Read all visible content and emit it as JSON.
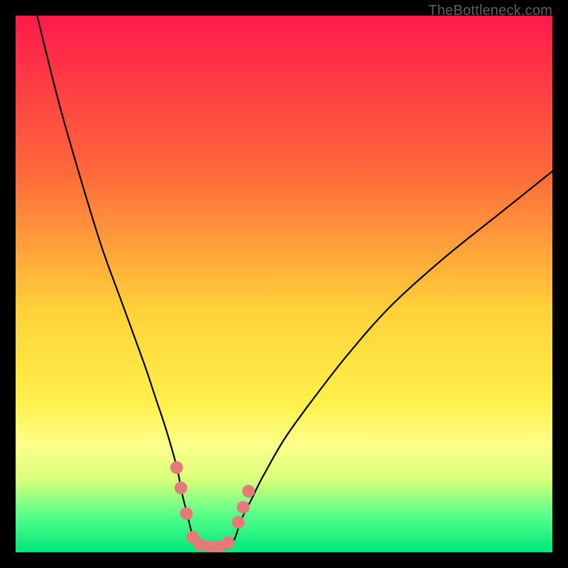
{
  "watermark": "TheBottleneck.com",
  "chart_data": {
    "type": "line",
    "title": "",
    "xlabel": "",
    "ylabel": "",
    "xlim": [
      0,
      100
    ],
    "ylim": [
      0,
      100
    ],
    "gradient_stops": [
      {
        "offset": 0.0,
        "color": "#ff1a4b"
      },
      {
        "offset": 0.3,
        "color": "#ff6b3a"
      },
      {
        "offset": 0.55,
        "color": "#ffd23a"
      },
      {
        "offset": 0.72,
        "color": "#fff04a"
      },
      {
        "offset": 0.8,
        "color": "#fdff8a"
      },
      {
        "offset": 0.865,
        "color": "#d8ff7a"
      },
      {
        "offset": 0.93,
        "color": "#58ff8a"
      },
      {
        "offset": 1.0,
        "color": "#00e77a"
      }
    ],
    "series": [
      {
        "name": "left-curve",
        "x": [
          4,
          8,
          12,
          16,
          20,
          24,
          26,
          28,
          30,
          31,
          32,
          33,
          34
        ],
        "y": [
          100,
          84,
          70,
          57,
          46,
          35,
          29,
          23,
          16,
          11,
          7,
          3,
          1
        ]
      },
      {
        "name": "right-curve",
        "x": [
          40,
          41,
          42,
          44,
          46,
          50,
          55,
          62,
          70,
          80,
          90,
          100
        ],
        "y": [
          1,
          3,
          6,
          10,
          14,
          21,
          28,
          37,
          46,
          55,
          63,
          71
        ]
      },
      {
        "name": "valley-floor",
        "x": [
          34,
          36,
          38,
          40
        ],
        "y": [
          1,
          0.5,
          0.5,
          1
        ]
      }
    ],
    "markers": {
      "color": "#e47a7a",
      "radius": 9,
      "points": [
        {
          "x": 30.0,
          "y": 15.8
        },
        {
          "x": 30.8,
          "y": 12.0
        },
        {
          "x": 31.8,
          "y": 7.2
        },
        {
          "x": 33.0,
          "y": 2.8
        },
        {
          "x": 34.3,
          "y": 1.4
        },
        {
          "x": 36.1,
          "y": 1.0
        },
        {
          "x": 38.0,
          "y": 1.0
        },
        {
          "x": 39.6,
          "y": 1.8
        },
        {
          "x": 41.5,
          "y": 5.6
        },
        {
          "x": 42.4,
          "y": 8.4
        },
        {
          "x": 43.4,
          "y": 11.4
        }
      ]
    }
  }
}
